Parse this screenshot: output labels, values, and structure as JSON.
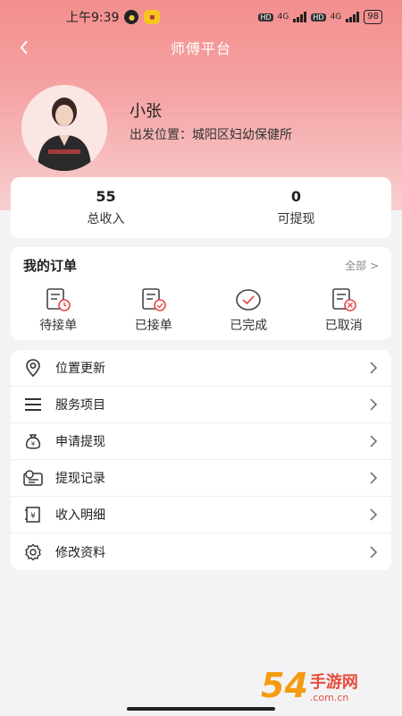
{
  "status_bar": {
    "time": "上午9:39",
    "hd1": "HD",
    "net1": "4G",
    "hd2": "HD",
    "net2": "4G",
    "battery": "98"
  },
  "nav": {
    "title": "师傅平台"
  },
  "profile": {
    "name": "小张",
    "location": "出发位置：城阳区妇幼保健所"
  },
  "stats": [
    {
      "value": "55",
      "label": "总收入"
    },
    {
      "value": "0",
      "label": "可提现"
    }
  ],
  "orders": {
    "title": "我的订单",
    "all_label": "全部 >",
    "items": [
      {
        "label": "待接单",
        "icon": "pending-order-icon"
      },
      {
        "label": "已接单",
        "icon": "accepted-order-icon"
      },
      {
        "label": "已完成",
        "icon": "completed-order-icon"
      },
      {
        "label": "已取消",
        "icon": "cancelled-order-icon"
      }
    ]
  },
  "menu": [
    {
      "label": "位置更新",
      "icon": "location-icon"
    },
    {
      "label": "服务项目",
      "icon": "list-icon"
    },
    {
      "label": "申请提现",
      "icon": "money-bag-icon"
    },
    {
      "label": "提现记录",
      "icon": "withdraw-record-icon"
    },
    {
      "label": "收入明细",
      "icon": "income-detail-icon"
    },
    {
      "label": "修改资料",
      "icon": "settings-icon"
    }
  ],
  "watermark": {
    "num": "54",
    "text": "手游网",
    "url": ".com.cn"
  },
  "colors": {
    "accent": "#f38e8e",
    "order_icon_red": "#e64a4a"
  }
}
